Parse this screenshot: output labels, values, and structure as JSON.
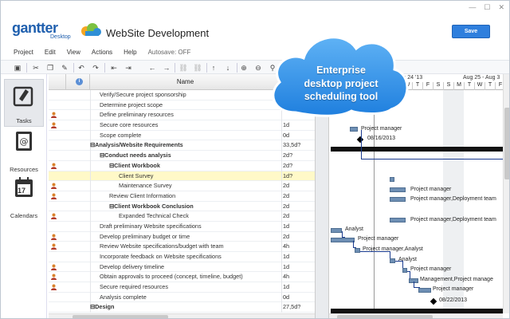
{
  "app": {
    "logo_main": "gantter",
    "logo_sub": "Desktop",
    "title": "WebSite Development",
    "save_label": "Save"
  },
  "menu": [
    "Project",
    "Edit",
    "View",
    "Actions",
    "Help"
  ],
  "autosave": "Autosave: OFF",
  "sidebar": [
    {
      "label": "Tasks",
      "icon": "tasks-icon",
      "selected": true
    },
    {
      "label": "Resources",
      "icon": "resources-icon"
    },
    {
      "label": "Calendars",
      "icon": "calendar-icon",
      "badge": "17"
    }
  ],
  "grid": {
    "name_header": "Name",
    "rows": [
      {
        "name": "Verify/Secure project sponsorship",
        "indent": 0,
        "bold": false,
        "dur": "",
        "user": false
      },
      {
        "name": "Determine project scope",
        "indent": 0,
        "bold": false,
        "dur": "",
        "user": false
      },
      {
        "name": "Define preliminary resources",
        "indent": 0,
        "bold": false,
        "dur": "",
        "user": true
      },
      {
        "name": "Secure core resources",
        "indent": 0,
        "bold": false,
        "dur": "1d",
        "user": true
      },
      {
        "name": "Scope complete",
        "indent": 0,
        "bold": false,
        "dur": "0d",
        "user": false
      },
      {
        "name": "⊟Analysis/Website Requirements",
        "indent": -1,
        "bold": true,
        "dur": "33,5d?",
        "user": false
      },
      {
        "name": "⊟Conduct needs analysis",
        "indent": 0,
        "bold": true,
        "dur": "2d?",
        "user": false
      },
      {
        "name": "⊟Client Workbook",
        "indent": 1,
        "bold": true,
        "dur": "2d?",
        "user": true
      },
      {
        "name": "Client Survey",
        "indent": 2,
        "bold": false,
        "dur": "1d?",
        "user": false,
        "hl": true
      },
      {
        "name": "Maintenance Survey",
        "indent": 2,
        "bold": false,
        "dur": "2d",
        "user": true
      },
      {
        "name": "Review Client Information",
        "indent": 1,
        "bold": false,
        "dur": "2d",
        "user": true
      },
      {
        "name": "⊟Client Workbook Conclusion",
        "indent": 1,
        "bold": true,
        "dur": "2d",
        "user": false
      },
      {
        "name": "Expanded Technical Check",
        "indent": 2,
        "bold": false,
        "dur": "2d",
        "user": true
      },
      {
        "name": "Draft preliminary Website specifications",
        "indent": 0,
        "bold": false,
        "dur": "1d",
        "user": false
      },
      {
        "name": "Develop preliminary budget or time",
        "indent": 0,
        "bold": false,
        "dur": "2d",
        "user": true
      },
      {
        "name": "Review Website specifications/budget with team",
        "indent": 0,
        "bold": false,
        "dur": "4h",
        "user": true
      },
      {
        "name": "Incorporate feedback on Website specifications",
        "indent": 0,
        "bold": false,
        "dur": "1d",
        "user": false
      },
      {
        "name": "Develop delivery timeline",
        "indent": 0,
        "bold": false,
        "dur": "1d",
        "user": true
      },
      {
        "name": "Obtain approvals to proceed (concept, timeline, budget)",
        "indent": 0,
        "bold": false,
        "dur": "4h",
        "user": true
      },
      {
        "name": "Secure required resources",
        "indent": 0,
        "bold": false,
        "dur": "1d",
        "user": true
      },
      {
        "name": "Analysis complete",
        "indent": 0,
        "bold": false,
        "dur": "0d",
        "user": false
      },
      {
        "name": "⊟Design",
        "indent": -1,
        "bold": true,
        "dur": "27,5d?",
        "user": false
      }
    ]
  },
  "gantt": {
    "week1": "- Aug 24 '13",
    "week2": "Aug 25 - Aug 3",
    "days": [
      "E",
      "W",
      "T",
      "F",
      "S",
      "S",
      "M",
      "T",
      "W",
      "T",
      "F",
      "S",
      "S"
    ],
    "labels": {
      "pm1": "Project manager",
      "date1": "08/16/2013",
      "pm2": "Project manager",
      "pmdt1": "Project manager,Deployment team",
      "pmdt2": "Project manager,Deployment team",
      "an1": "Analyst",
      "pm3": "Project manager",
      "pman": "Project manager,Analyst",
      "an2": "Analyst",
      "pm4": "Project manager",
      "mgmt": "Management,Project manage",
      "pm5": "Project manager",
      "date2": "08/22/2013"
    }
  },
  "promo": {
    "line1": "Enterprise",
    "line2": "desktop project",
    "line3": "scheduling tool"
  }
}
